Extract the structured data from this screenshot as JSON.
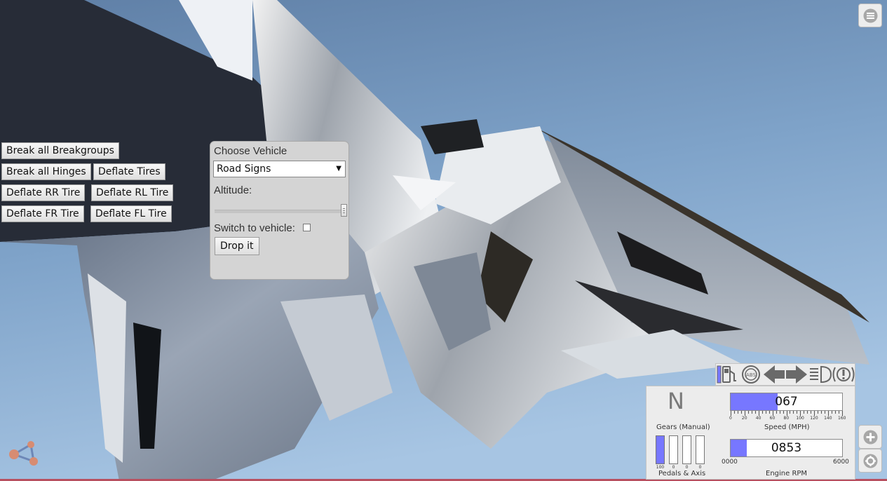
{
  "debug_buttons": {
    "break_all_breakgroups": "Break all Breakgroups",
    "break_all_hinges": "Break all Hinges",
    "deflate_tires": "Deflate Tires",
    "deflate_rr_tire": "Deflate RR Tire",
    "deflate_rl_tire": "Deflate RL Tire",
    "deflate_fr_tire": "Deflate FR Tire",
    "deflate_fl_tire": "Deflate FL Tire"
  },
  "vehicle_panel": {
    "title": "Choose Vehicle",
    "selected_vehicle": "Road Signs",
    "dropdown_arrow": "▼",
    "altitude_label": "Altitude:",
    "altitude_level": 1.0,
    "switch_label": "Switch to vehicle:",
    "switch_checked": false,
    "drop_label": "Drop it"
  },
  "dashboard": {
    "gear": "N",
    "gear_caption": "Gears (Manual)",
    "speed_value": "067",
    "speed_max": 160,
    "speed_ticks": [
      "0",
      "20",
      "40",
      "60",
      "80",
      "100",
      "120",
      "140",
      "160"
    ],
    "speed_caption": "Speed (MPH)",
    "rpm_value": "0853",
    "rpm_min_label": "0000",
    "rpm_max_label": "6000",
    "rpm_max": 6000,
    "rpm_caption": "Engine RPM",
    "pedals": [
      {
        "name": "throttle",
        "value": "100",
        "level": 1.0
      },
      {
        "name": "brake",
        "value": "0",
        "level": 0
      },
      {
        "name": "clutch",
        "value": "0",
        "level": 0
      },
      {
        "name": "parking",
        "value": "0",
        "level": 0
      }
    ],
    "pedals_caption": "Pedals & Axis",
    "indicator_icons": [
      "fuel-icon",
      "abs-icon",
      "left-turn-signal-icon",
      "right-turn-signal-icon",
      "headlight-icon",
      "warning-icon"
    ]
  },
  "side_icons": [
    "menu-icon",
    "zoom-in-icon",
    "settings-icon",
    "share-icon"
  ],
  "colors": {
    "sky": "#8fb2d6",
    "gauge_fill": "#7777ff",
    "panel_bg": "#d4d4d4",
    "dashboard_bg": "#ececec"
  }
}
